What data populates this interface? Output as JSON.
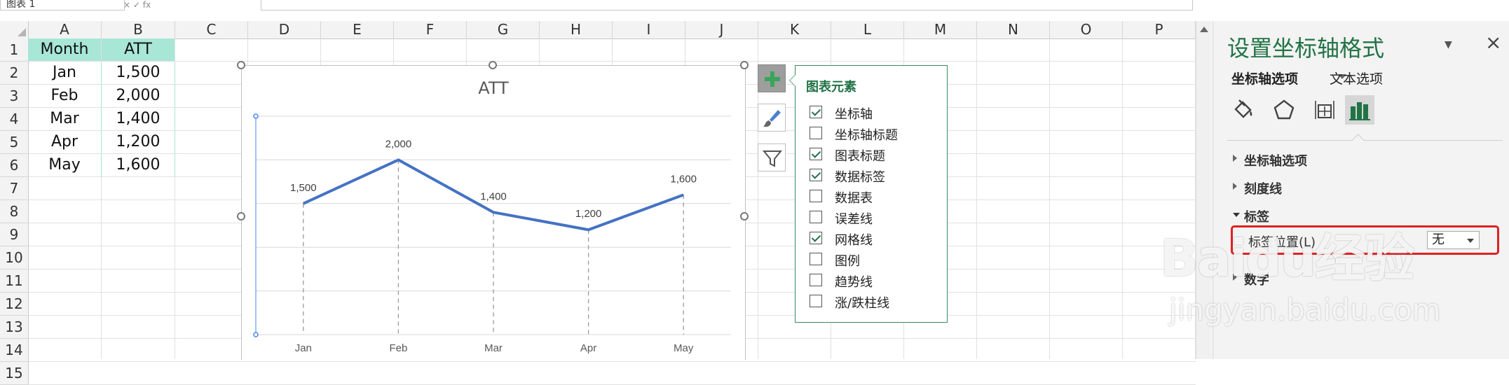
{
  "formula_bar": {
    "name_box": "图表 1",
    "fx_text": "× ✓ fx"
  },
  "columns": [
    "A",
    "B",
    "C",
    "D",
    "E",
    "F",
    "G",
    "H",
    "I",
    "J",
    "K",
    "L",
    "M",
    "N",
    "O",
    "P"
  ],
  "rows": [
    "1",
    "2",
    "3",
    "4",
    "5",
    "6",
    "7",
    "8",
    "9",
    "10",
    "11",
    "12",
    "13",
    "14",
    "15"
  ],
  "table": {
    "headers": [
      "Month",
      "ATT"
    ],
    "rows": [
      [
        "Jan",
        "1,500"
      ],
      [
        "Feb",
        "2,000"
      ],
      [
        "Mar",
        "1,400"
      ],
      [
        "Apr",
        "1,200"
      ],
      [
        "May",
        "1,600"
      ]
    ]
  },
  "chart_data": {
    "type": "line",
    "title": "ATT",
    "categories": [
      "Jan",
      "Feb",
      "Mar",
      "Apr",
      "May"
    ],
    "series": [
      {
        "values": [
          1500,
          2000,
          1400,
          1200,
          1600
        ]
      }
    ],
    "data_labels": [
      "1,500",
      "2,000",
      "1,400",
      "1,200",
      "1,600"
    ],
    "ylim": [
      0,
      2500
    ],
    "grid": true,
    "drop_lines": true,
    "value_axis_labels": "none",
    "line_color": "#4472C4"
  },
  "chart_elements_popup": {
    "title": "图表元素",
    "items": [
      {
        "label": "坐标轴",
        "checked": true
      },
      {
        "label": "坐标轴标题",
        "checked": false
      },
      {
        "label": "图表标题",
        "checked": true
      },
      {
        "label": "数据标签",
        "checked": true
      },
      {
        "label": "数据表",
        "checked": false
      },
      {
        "label": "误差线",
        "checked": false
      },
      {
        "label": "网格线",
        "checked": true
      },
      {
        "label": "图例",
        "checked": false
      },
      {
        "label": "趋势线",
        "checked": false
      },
      {
        "label": "涨/跌柱线",
        "checked": false
      }
    ]
  },
  "side_buttons": [
    {
      "name": "chart-elements-button",
      "icon": "plus-icon"
    },
    {
      "name": "chart-styles-button",
      "icon": "brush-icon"
    },
    {
      "name": "chart-filters-button",
      "icon": "filter-icon"
    }
  ],
  "format_pane": {
    "title": "设置坐标轴格式",
    "tab_axis": "坐标轴选项",
    "tab_text": "文本选项",
    "sections": {
      "axis_options": "坐标轴选项",
      "tick_marks": "刻度线",
      "labels": "标签",
      "number": "数字"
    },
    "label_position_label": "标签位置(L)",
    "label_position_value": "无"
  },
  "watermark": {
    "line1": "Baidu经验",
    "line2": "jingyan.baidu.com"
  },
  "colors": {
    "accent": "#217346",
    "header_fill": "#a8e6d6",
    "highlight": "#e02020",
    "series": "#4472C4"
  }
}
